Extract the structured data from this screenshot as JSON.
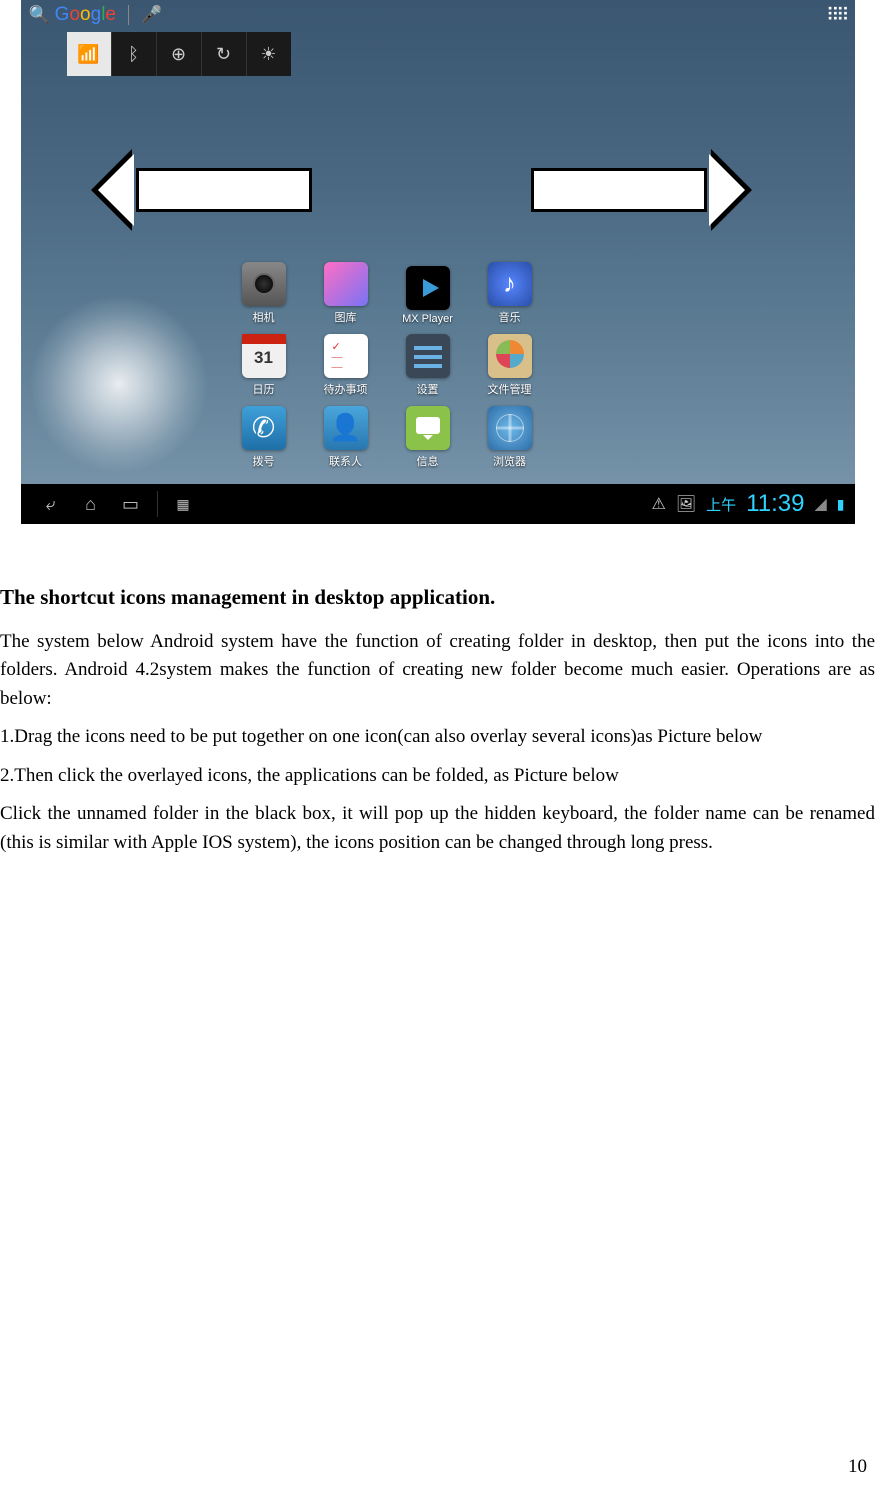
{
  "topbar": {
    "search": "Google"
  },
  "apps": [
    {
      "label": "相机",
      "icon": "camera"
    },
    {
      "label": "图库",
      "icon": "gallery"
    },
    {
      "label": "MX Player",
      "icon": "mx"
    },
    {
      "label": "音乐",
      "icon": "music"
    },
    {
      "label": "日历",
      "icon": "cal"
    },
    {
      "label": "待办事项",
      "icon": "todo"
    },
    {
      "label": "设置",
      "icon": "settings"
    },
    {
      "label": "文件管理",
      "icon": "file"
    },
    {
      "label": "拨号",
      "icon": "phone"
    },
    {
      "label": "联系人",
      "icon": "contacts"
    },
    {
      "label": "信息",
      "icon": "msg"
    },
    {
      "label": "浏览器",
      "icon": "browser"
    }
  ],
  "navbar": {
    "period": "上午",
    "time": "11:39"
  },
  "doc": {
    "heading": "The shortcut icons management in desktop application.",
    "p1": "The system below Android system have the function of creating folder in desktop, then put the icons into the folders. Android 4.2system makes the function of creating new folder become much easier. Operations are as below:",
    "p2": "1.Drag the icons need to be put together on one icon(can also overlay several icons)as Picture below",
    "p3": "2.Then click the overlayed icons, the applications can be folded, as Picture below",
    "p4": "Click the unnamed folder in the black box, it will pop up the hidden keyboard, the folder name can be renamed (this is similar with Apple IOS system), the icons position can be changed through long press.",
    "pagenum": "10"
  }
}
